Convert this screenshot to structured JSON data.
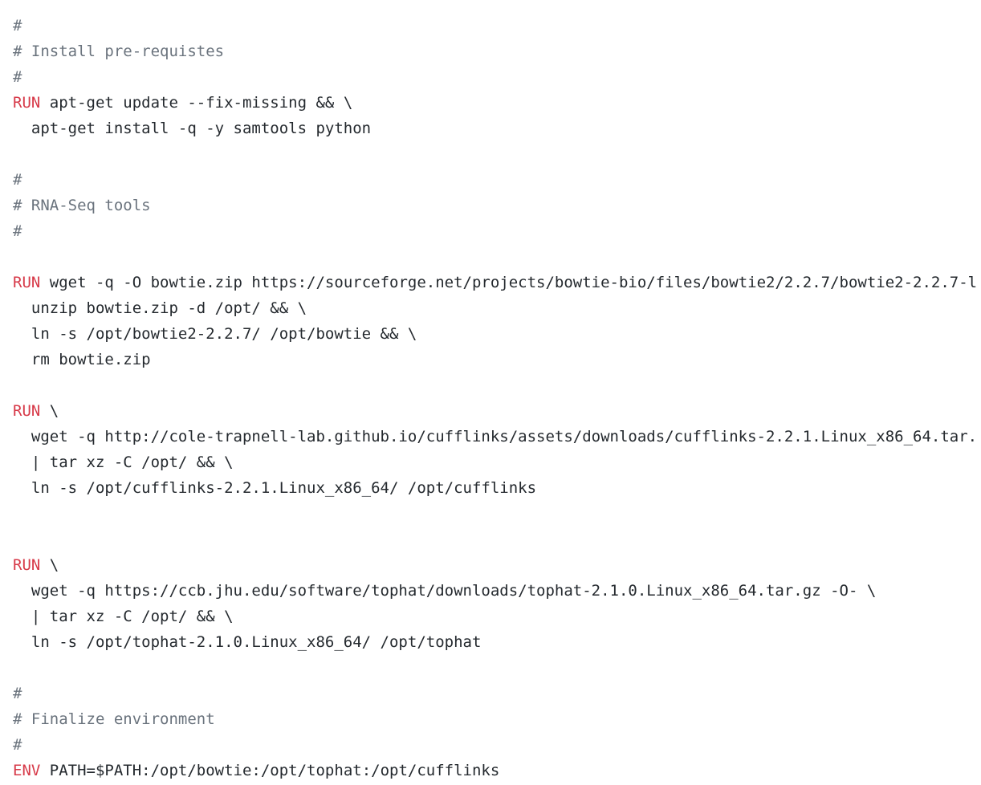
{
  "code": {
    "lines": [
      {
        "type": "comment",
        "text": "#"
      },
      {
        "type": "comment",
        "text": "# Install pre-requistes"
      },
      {
        "type": "comment",
        "text": "#"
      },
      {
        "type": "instr",
        "kw": "RUN",
        "text": " apt-get update --fix-missing && \\"
      },
      {
        "type": "text",
        "text": "  apt-get install -q -y samtools python"
      },
      {
        "type": "blank",
        "text": ""
      },
      {
        "type": "comment",
        "text": "#"
      },
      {
        "type": "comment",
        "text": "# RNA-Seq tools"
      },
      {
        "type": "comment",
        "text": "#"
      },
      {
        "type": "blank",
        "text": ""
      },
      {
        "type": "instr",
        "kw": "RUN",
        "text": " wget -q -O bowtie.zip https://sourceforge.net/projects/bowtie-bio/files/bowtie2/2.2.7/bowtie2-2.2.7-l"
      },
      {
        "type": "text",
        "text": "  unzip bowtie.zip -d /opt/ && \\"
      },
      {
        "type": "text",
        "text": "  ln -s /opt/bowtie2-2.2.7/ /opt/bowtie && \\"
      },
      {
        "type": "text",
        "text": "  rm bowtie.zip"
      },
      {
        "type": "blank",
        "text": ""
      },
      {
        "type": "instr",
        "kw": "RUN",
        "text": " \\"
      },
      {
        "type": "text",
        "text": "  wget -q http://cole-trapnell-lab.github.io/cufflinks/assets/downloads/cufflinks-2.2.1.Linux_x86_64.tar."
      },
      {
        "type": "text",
        "text": "  | tar xz -C /opt/ && \\"
      },
      {
        "type": "text",
        "text": "  ln -s /opt/cufflinks-2.2.1.Linux_x86_64/ /opt/cufflinks"
      },
      {
        "type": "blank",
        "text": ""
      },
      {
        "type": "blank",
        "text": ""
      },
      {
        "type": "instr",
        "kw": "RUN",
        "text": " \\"
      },
      {
        "type": "text",
        "text": "  wget -q https://ccb.jhu.edu/software/tophat/downloads/tophat-2.1.0.Linux_x86_64.tar.gz -O- \\"
      },
      {
        "type": "text",
        "text": "  | tar xz -C /opt/ && \\"
      },
      {
        "type": "text",
        "text": "  ln -s /opt/tophat-2.1.0.Linux_x86_64/ /opt/tophat"
      },
      {
        "type": "blank",
        "text": ""
      },
      {
        "type": "comment",
        "text": "#"
      },
      {
        "type": "comment",
        "text": "# Finalize environment"
      },
      {
        "type": "comment",
        "text": "#"
      },
      {
        "type": "instr",
        "kw": "ENV",
        "text": " PATH=$PATH:/opt/bowtie:/opt/tophat:/opt/cufflinks"
      }
    ]
  },
  "colors": {
    "keyword": "#d73a49",
    "comment": "#6a737d",
    "text": "#24292e",
    "background": "#ffffff"
  }
}
